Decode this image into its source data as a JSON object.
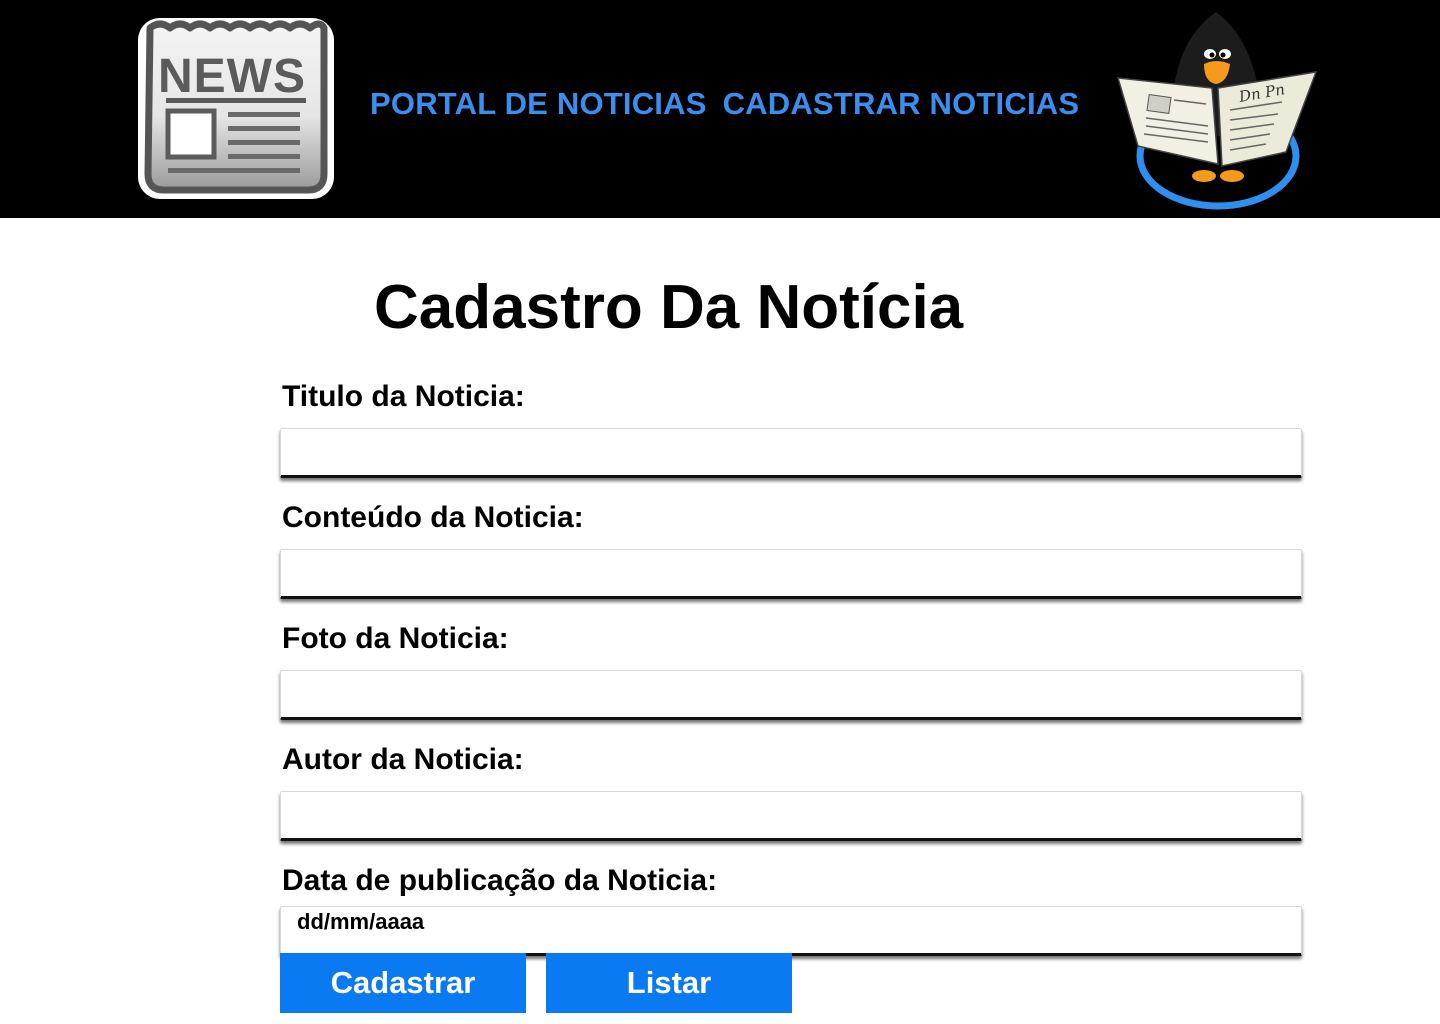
{
  "header": {
    "logo_icon": "news-paper-icon",
    "logo_text": "NEWS",
    "nav": [
      {
        "label": "PORTAL DE NOTICIAS"
      },
      {
        "label": "CADASTRAR NOTICIAS"
      }
    ],
    "mascot_icon": "penguin-reading-newspaper-icon",
    "nav_color": "#3a8ef0",
    "background": "#000000"
  },
  "main": {
    "title": "Cadastro Da Notícia",
    "fields": [
      {
        "label": "Titulo da Noticia:",
        "value": ""
      },
      {
        "label": "Conteúdo da Noticia:",
        "value": ""
      },
      {
        "label": "Foto da Noticia:",
        "value": ""
      },
      {
        "label": "Autor da Noticia:",
        "value": ""
      },
      {
        "label": "Data de publicação da Noticia:",
        "placeholder": "dd/mm/aaaa"
      }
    ],
    "buttons": {
      "submit_label": "Cadastrar",
      "list_label": "Listar",
      "color": "#0a7af3"
    }
  }
}
